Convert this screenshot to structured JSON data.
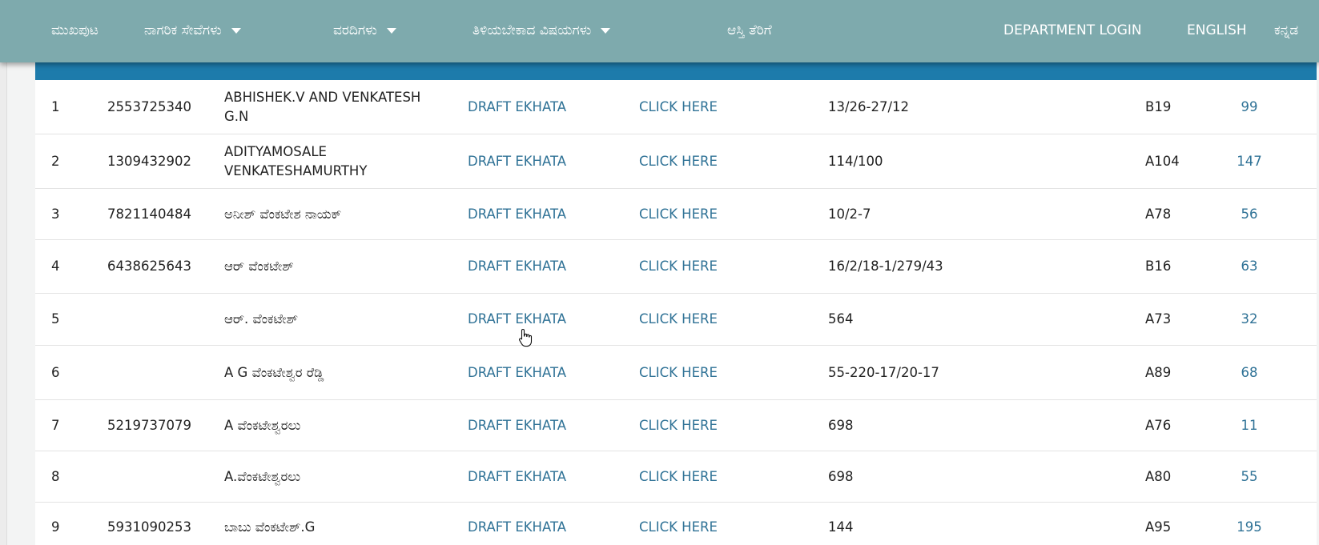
{
  "nav": {
    "home": "ಮುಖಪುಟ",
    "citizen_services": "ನಾಗರಿಕ ಸೇವೆಗಳು",
    "reports": "ವರದಿಗಳು",
    "know_topics": "ತಿಳಿಯಬೇಕಾದ ವಿಷಯಗಳು",
    "property_tax": "ಆಸ್ತಿ ತೆರಿಗೆ",
    "department_login": "DEPARTMENT LOGIN",
    "english": "ENGLISH",
    "kannada": "ಕನ್ನಡ"
  },
  "colors": {
    "navbar": "#7eaaad",
    "table_header": "#1d7bab",
    "link": "#2f7296"
  },
  "rows": [
    {
      "sn": "1",
      "id": "2553725340",
      "name": "ABHISHEK.V AND VENKATESH G.N",
      "draft": "DRAFT EKHATA",
      "click": "CLICK HERE",
      "prop_no": "13/26-27/12",
      "block": "B19",
      "num": "99"
    },
    {
      "sn": "2",
      "id": "1309432902",
      "name": "ADITYAMOSALE VENKATESHAMURTHY",
      "draft": "DRAFT EKHATA",
      "click": "CLICK HERE",
      "prop_no": "114/100",
      "block": "A104",
      "num": "147"
    },
    {
      "sn": "3",
      "id": "7821140484",
      "name": "ಅನೀಶ್ ವೆಂಕಟೇಶ ನಾಯಕ್",
      "draft": "DRAFT EKHATA",
      "click": "CLICK HERE",
      "prop_no": "10/2-7",
      "block": "A78",
      "num": "56"
    },
    {
      "sn": "4",
      "id": "6438625643",
      "name": "ಆರ್ ವೆಂಕಟೇಶ್",
      "draft": "DRAFT EKHATA",
      "click": "CLICK HERE",
      "prop_no": "16/2/18-1/279/43",
      "block": "B16",
      "num": "63"
    },
    {
      "sn": "5",
      "id": "",
      "name": "ಆರ್. ವೆಂಕಟೇಶ್",
      "draft": "DRAFT EKHATA",
      "click": "CLICK HERE",
      "prop_no": "564",
      "block": "A73",
      "num": "32"
    },
    {
      "sn": "6",
      "id": "",
      "name": "A G ವೆಂಕಟೇಶ್ವರ ರೆಡ್ಡಿ",
      "draft": "DRAFT EKHATA",
      "click": "CLICK HERE",
      "prop_no": "55-220-17/20-17",
      "block": "A89",
      "num": "68"
    },
    {
      "sn": "7",
      "id": "5219737079",
      "name": "A ವೆಂಕಟೇಶ್ವರಲು",
      "draft": "DRAFT EKHATA",
      "click": "CLICK HERE",
      "prop_no": "698",
      "block": "A76",
      "num": "11"
    },
    {
      "sn": "8",
      "id": "",
      "name": "A.ವೆಂಕಟೇಶ್ವರಲು",
      "draft": "DRAFT EKHATA",
      "click": "CLICK HERE",
      "prop_no": "698",
      "block": "A80",
      "num": "55"
    },
    {
      "sn": "9",
      "id": "5931090253",
      "name": "ಬಾಬು ವೆಂಕಟೇಶ್.G",
      "draft": "DRAFT EKHATA",
      "click": "CLICK HERE",
      "prop_no": "144",
      "block": "A95",
      "num": "195"
    }
  ]
}
